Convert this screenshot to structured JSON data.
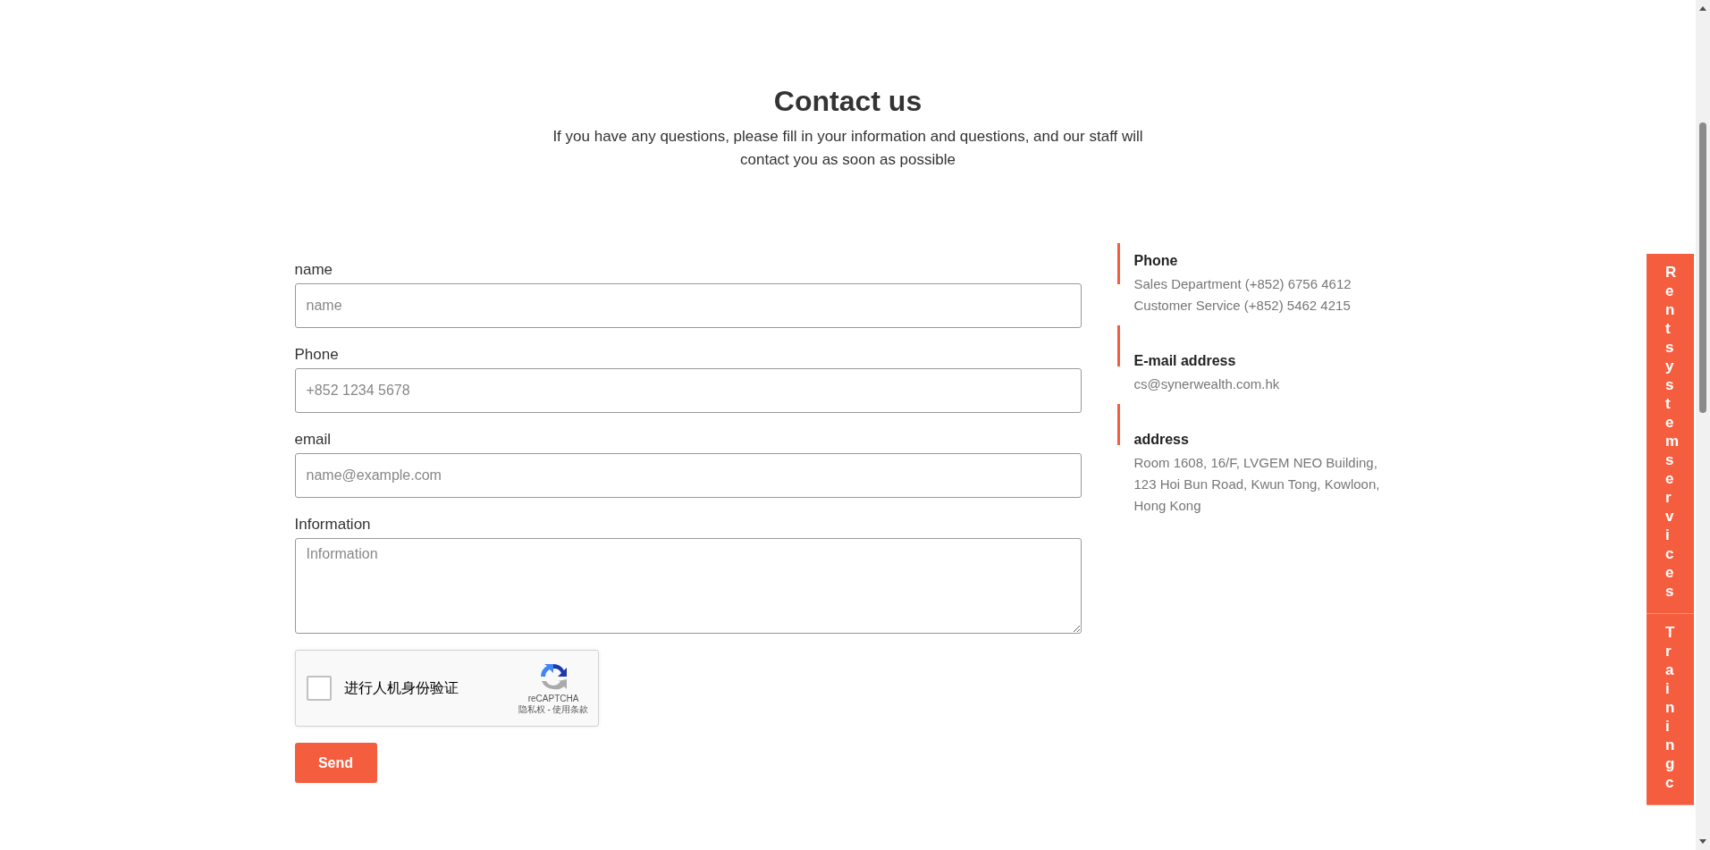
{
  "heading": {
    "title": "Contact us",
    "subtitle": "If you have any questions, please fill in your information and questions, and our staff will contact you as soon as possible"
  },
  "form": {
    "fields": [
      {
        "kind": "input",
        "label": "name",
        "placeholder": "name"
      },
      {
        "kind": "input",
        "label": "Phone",
        "placeholder": "+852 1234 5678"
      },
      {
        "kind": "input",
        "label": "email",
        "placeholder": "name@example.com"
      },
      {
        "kind": "textarea",
        "label": "Information",
        "placeholder": "Information"
      }
    ],
    "captcha": {
      "label": "进行人机身份验证",
      "checked": false,
      "brand": "reCAPTCHA",
      "terms": "隐私权 - 使用条款"
    },
    "submit": "Send"
  },
  "contact": [
    {
      "title": "Phone",
      "lines": [
        "Sales Department (+852) 6756 4612",
        "Customer Service (+852) 5462 4215"
      ]
    },
    {
      "title": "E-mail address",
      "lines": [
        "cs@synerwealth.com.hk"
      ]
    },
    {
      "title": "address",
      "lines": [
        "Room 1608, 16/F, LVGEM NEO Building, 123 Hoi Bun Road, Kwun Tong, Kowloon, Hong Kong"
      ]
    }
  ],
  "side_tabs": [
    {
      "label": "Rent system services"
    },
    {
      "label": "Training c"
    }
  ]
}
